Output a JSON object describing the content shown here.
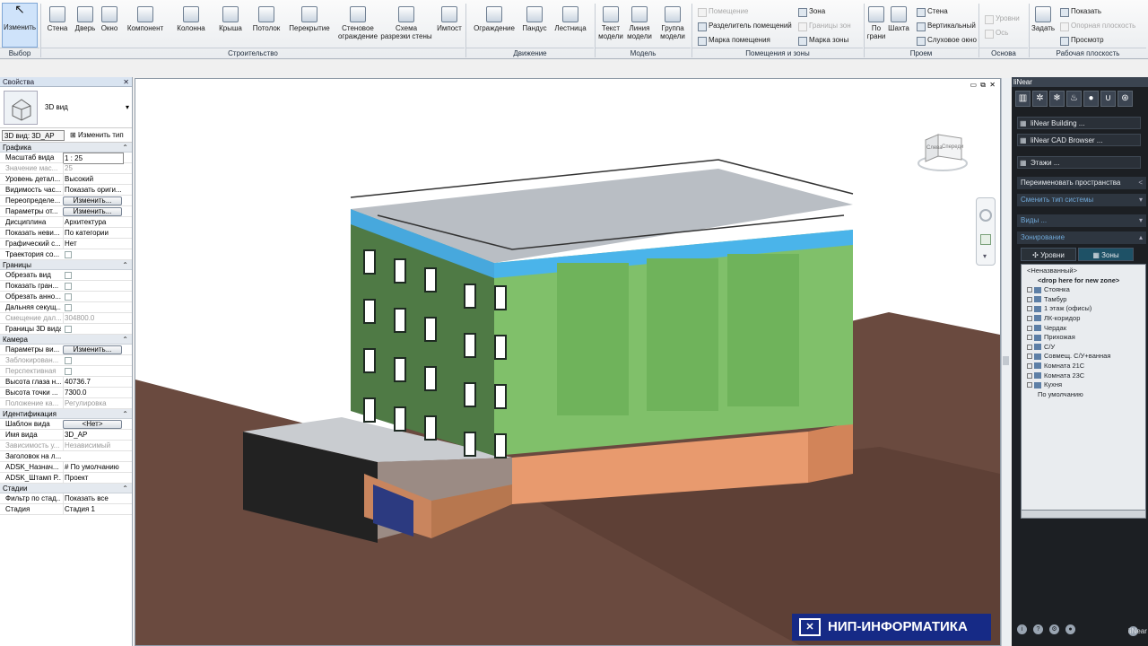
{
  "ribbon": {
    "buttons": [
      {
        "label": "Изменить",
        "icon": "cursor-icon"
      },
      {
        "label": "Стена",
        "icon": "wall-icon"
      },
      {
        "label": "Дверь",
        "icon": "door-icon"
      },
      {
        "label": "Окно",
        "icon": "window-icon"
      },
      {
        "label": "Компонент",
        "icon": "component-icon"
      },
      {
        "label": "Колонна",
        "icon": "column-icon"
      },
      {
        "label": "Крыша",
        "icon": "roof-icon"
      },
      {
        "label": "Потолок",
        "icon": "ceiling-icon"
      },
      {
        "label": "Перекрытие",
        "icon": "floor-icon"
      },
      {
        "label": "Стеновое ограждение",
        "icon": "curtain-wall-icon"
      },
      {
        "label": "Схема разрезки стены",
        "icon": "curtain-grid-icon"
      },
      {
        "label": "Импост",
        "icon": "mullion-icon"
      },
      {
        "label": "Ограждение",
        "icon": "railing-icon"
      },
      {
        "label": "Пандус",
        "icon": "ramp-icon"
      },
      {
        "label": "Лестница",
        "icon": "stair-icon"
      },
      {
        "label": "Текст модели",
        "icon": "model-text-icon"
      },
      {
        "label": "Линия модели",
        "icon": "model-line-icon"
      },
      {
        "label": "Группа модели",
        "icon": "model-group-icon"
      },
      {
        "label": "По грани",
        "icon": "by-face-icon"
      },
      {
        "label": "Шахта",
        "icon": "shaft-icon"
      },
      {
        "label": "Задать",
        "icon": "set-workplane-icon"
      }
    ],
    "small": {
      "room": "Помещение",
      "room_sep": "Разделитель помещений",
      "room_tag": "Марка помещения",
      "zone": "Зона",
      "zone_bounds": "Границы зон",
      "zone_tag": "Марка зоны",
      "wall": "Стена",
      "vertical": "Вертикальный",
      "dormer": "Слуховое окно",
      "levels": "Уровни",
      "axes": "Ось",
      "show": "Показать",
      "ref_plane": "Опорная плоскость",
      "viewer": "Просмотр"
    },
    "groups": [
      "Выбор",
      "Строительство",
      "Движение",
      "Модель",
      "Помещения и зоны",
      "Проем",
      "Основа",
      "Рабочая плоскость"
    ]
  },
  "properties": {
    "title": "Свойства",
    "type_label": "3D вид",
    "view_select": "3D вид: 3D_AP",
    "change_type": "Изменить тип",
    "sections": [
      {
        "name": "Графика",
        "rows": [
          {
            "k": "Масштаб вида",
            "v": "1 : 25",
            "kind": "input"
          },
          {
            "k": "Значение мас...",
            "v": "25",
            "kind": "dis"
          },
          {
            "k": "Уровень детал...",
            "v": "Высокий",
            "kind": "text"
          },
          {
            "k": "Видимость час...",
            "v": "Показать ориги...",
            "kind": "text"
          },
          {
            "k": "Переопределе...",
            "v": "Изменить...",
            "kind": "btn"
          },
          {
            "k": "Параметры от...",
            "v": "Изменить...",
            "kind": "btn"
          },
          {
            "k": "Дисциплина",
            "v": "Архитектура",
            "kind": "text"
          },
          {
            "k": "Показать неви...",
            "v": "По категории",
            "kind": "text"
          },
          {
            "k": "Графический с...",
            "v": "Нет",
            "kind": "text"
          },
          {
            "k": "Траектория со...",
            "v": "",
            "kind": "cb"
          }
        ]
      },
      {
        "name": "Границы",
        "rows": [
          {
            "k": "Обрезать вид",
            "v": "",
            "kind": "cb"
          },
          {
            "k": "Показать гран...",
            "v": "",
            "kind": "cb"
          },
          {
            "k": "Обрезать анно...",
            "v": "",
            "kind": "cb"
          },
          {
            "k": "Дальняя секущ...",
            "v": "",
            "kind": "cb"
          },
          {
            "k": "Смещение дал...",
            "v": "304800.0",
            "kind": "dis"
          },
          {
            "k": "Границы 3D вида",
            "v": "",
            "kind": "cb"
          }
        ]
      },
      {
        "name": "Камера",
        "rows": [
          {
            "k": "Параметры ви...",
            "v": "Изменить...",
            "kind": "btn"
          },
          {
            "k": "Заблокирован...",
            "v": "",
            "kind": "cbdis"
          },
          {
            "k": "Перспективная",
            "v": "",
            "kind": "cbdis"
          },
          {
            "k": "Высота глаза н...",
            "v": "40736.7",
            "kind": "text"
          },
          {
            "k": "Высота точки ...",
            "v": "7300.0",
            "kind": "text"
          },
          {
            "k": "Положение ка...",
            "v": "Регулировка",
            "kind": "dis"
          }
        ]
      },
      {
        "name": "Идентификация",
        "rows": [
          {
            "k": "Шаблон вида",
            "v": "<Нет>",
            "kind": "btn"
          },
          {
            "k": "Имя вида",
            "v": "3D_AP",
            "kind": "text"
          },
          {
            "k": "Зависимость у...",
            "v": "Независимый",
            "kind": "dis"
          },
          {
            "k": "Заголовок на л...",
            "v": "",
            "kind": "text"
          },
          {
            "k": "ADSK_Назнач...",
            "v": "# По умолчанию",
            "kind": "text"
          },
          {
            "k": "ADSK_Штамп Р...",
            "v": "Проект",
            "kind": "text"
          }
        ]
      },
      {
        "name": "Стадии",
        "rows": [
          {
            "k": "Фильтр по стад...",
            "v": "Показать все",
            "kind": "text"
          },
          {
            "k": "Стадия",
            "v": "Стадия 1",
            "kind": "text"
          }
        ]
      }
    ]
  },
  "viewcube": {
    "left": "Слева",
    "front": "Спереди"
  },
  "brand": {
    "logo": "НИП-ИНФОРМАТИКА"
  },
  "linear": {
    "title": "liNear",
    "buttons": [
      "liNear Building ...",
      "liNear CAD Browser ...",
      "Этажи ..."
    ],
    "rename_spaces": "Переименовать пространства",
    "change_system": "Сменить тип системы",
    "views": "Виды ...",
    "zoning": "Зонирование",
    "tab_levels": "Уровни",
    "tab_zones": "Зоны",
    "tree_root": "<Неназванный>",
    "tree_drop": "<drop here for new zone>",
    "zones": [
      "Стоянка",
      "Тамбур",
      "1 этаж (офисы)",
      "ЛК-коридор",
      "Чердак",
      "Прихожая",
      "С/У",
      "Совмещ. С/У+ванная",
      "Комната 21С",
      "Комната 23С",
      "Кухня"
    ],
    "tree_default": "По умолчанию",
    "footer_brand": "liNear"
  }
}
